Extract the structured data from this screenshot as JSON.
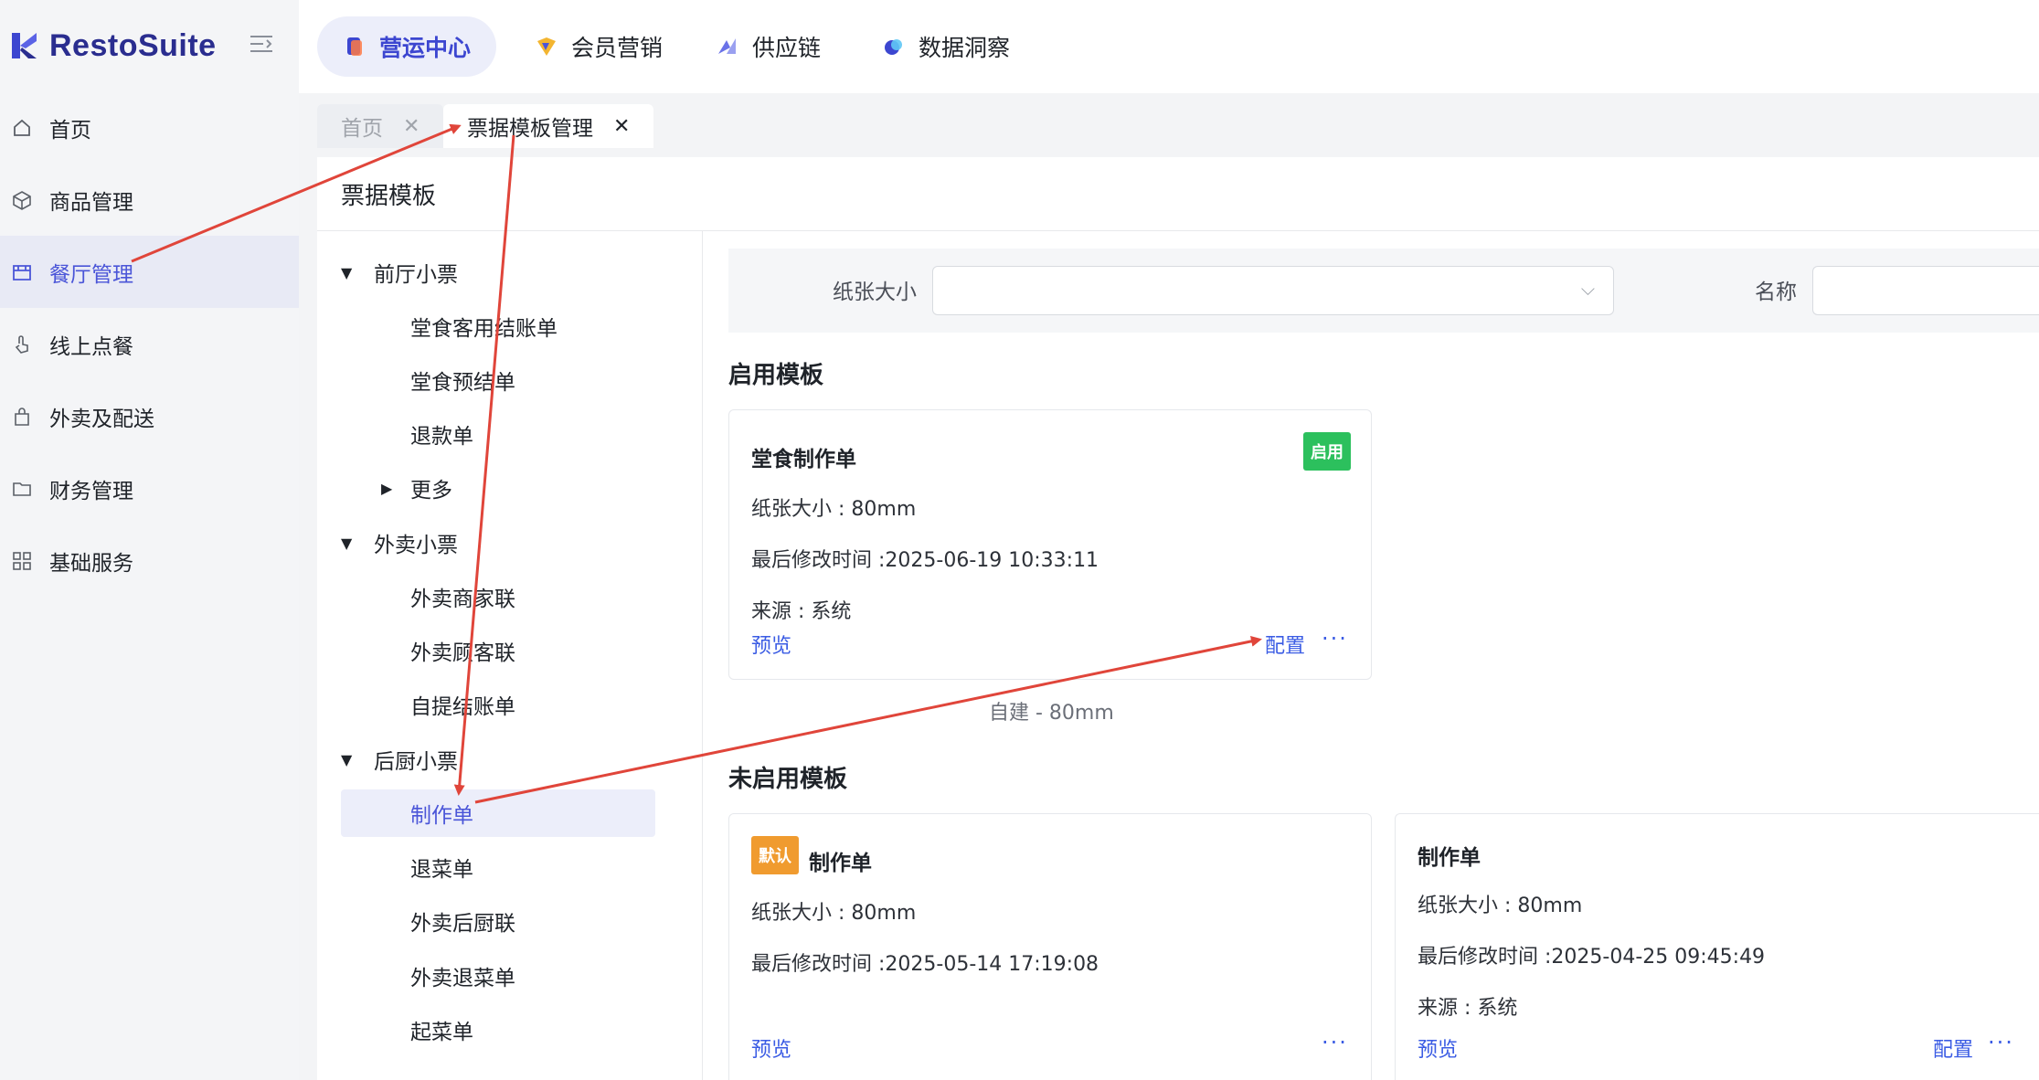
{
  "brand": {
    "name": "RestoSuite"
  },
  "sidebar": {
    "items": [
      {
        "label": "首页",
        "icon": "home-icon"
      },
      {
        "label": "商品管理",
        "icon": "box-icon"
      },
      {
        "label": "餐厅管理",
        "icon": "store-icon",
        "active": true
      },
      {
        "label": "线上点餐",
        "icon": "tap-icon"
      },
      {
        "label": "外卖及配送",
        "icon": "bag-icon"
      },
      {
        "label": "财务管理",
        "icon": "folder-icon"
      },
      {
        "label": "基础服务",
        "icon": "grid-icon"
      }
    ]
  },
  "topnav": {
    "tabs": [
      {
        "label": "营运中心",
        "active": true
      },
      {
        "label": "会员营销"
      },
      {
        "label": "供应链"
      },
      {
        "label": "数据洞察"
      }
    ]
  },
  "page_tabs": [
    {
      "label": "首页"
    },
    {
      "label": "票据模板管理",
      "active": true
    }
  ],
  "panel": {
    "title": "票据模板"
  },
  "tree": {
    "groups": [
      {
        "label": "前厅小票",
        "items": [
          "堂食客用结账单",
          "堂食预结单",
          "退款单"
        ],
        "more": "更多"
      },
      {
        "label": "外卖小票",
        "items": [
          "外卖商家联",
          "外卖顾客联",
          "自提结账单"
        ]
      },
      {
        "label": "后厨小票",
        "items": [
          "制作单",
          "退菜单",
          "外卖后厨联",
          "外卖退菜单",
          "起菜单"
        ],
        "selected": "制作单"
      }
    ]
  },
  "filter": {
    "paper_size_label": "纸张大小",
    "name_label": "名称"
  },
  "enabled_section": {
    "title": "启用模板",
    "cards": [
      {
        "title": "堂食制作单",
        "badge": "启用",
        "paper": "纸张大小 : 80mm",
        "modified": "最后修改时间 :2025-06-19 10:33:11",
        "source": "来源 : 系统",
        "preview": "预览",
        "config": "配置",
        "more": "···"
      }
    ],
    "caption": "自建 - 80mm"
  },
  "disabled_section": {
    "title": "未启用模板",
    "cards": [
      {
        "badge": "默认",
        "title": "制作单",
        "paper": "纸张大小 : 80mm",
        "modified": "最后修改时间 :2025-05-14 17:19:08",
        "preview": "预览",
        "more": "···"
      },
      {
        "title": "制作单",
        "paper": "纸张大小 : 80mm",
        "modified": "最后修改时间 :2025-04-25 09:45:49",
        "source": "来源 : 系统",
        "preview": "预览",
        "config": "配置",
        "more": "···"
      }
    ]
  },
  "colors": {
    "accent": "#4a55d8",
    "link": "#3b5ce4",
    "enabled_badge": "#2cc05d",
    "default_badge": "#f09b2f",
    "annotation_arrow": "#e0453a"
  }
}
